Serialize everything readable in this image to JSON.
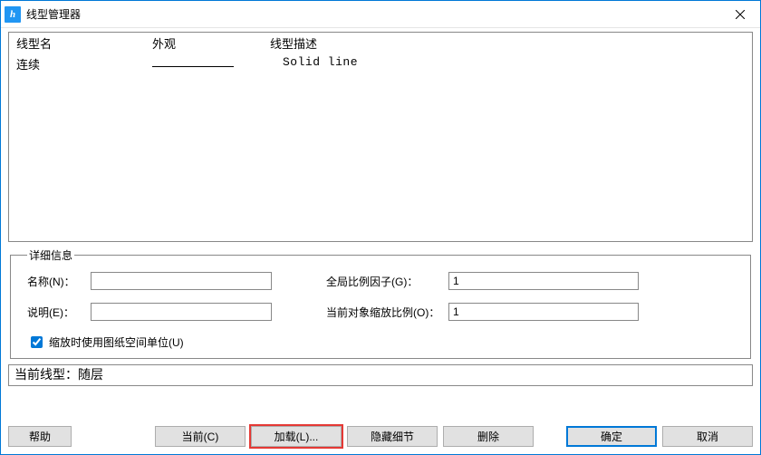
{
  "window": {
    "title": "线型管理器",
    "app_icon_glyph": "h"
  },
  "list": {
    "headers": {
      "name": "线型名",
      "appearance": "外观",
      "description": "线型描述"
    },
    "rows": [
      {
        "name": "连续",
        "description": "Solid line"
      }
    ]
  },
  "details": {
    "legend": "详细信息",
    "name_label": "名称(N)：",
    "name_value": "",
    "desc_label": "说明(E)：",
    "desc_value": "",
    "global_scale_label": "全局比例因子(G)：",
    "global_scale_value": "1",
    "object_scale_label": "当前对象缩放比例(O)：",
    "object_scale_value": "1",
    "paper_units_label": "缩放时使用图纸空间单位(U)"
  },
  "current_line": {
    "label_prefix": "当前线型：",
    "value": "随层"
  },
  "buttons": {
    "help": "帮助",
    "current": "当前(C)",
    "load": "加载(L)...",
    "hide_details": "隐藏细节",
    "delete": "删除",
    "ok": "确定",
    "cancel": "取消"
  }
}
